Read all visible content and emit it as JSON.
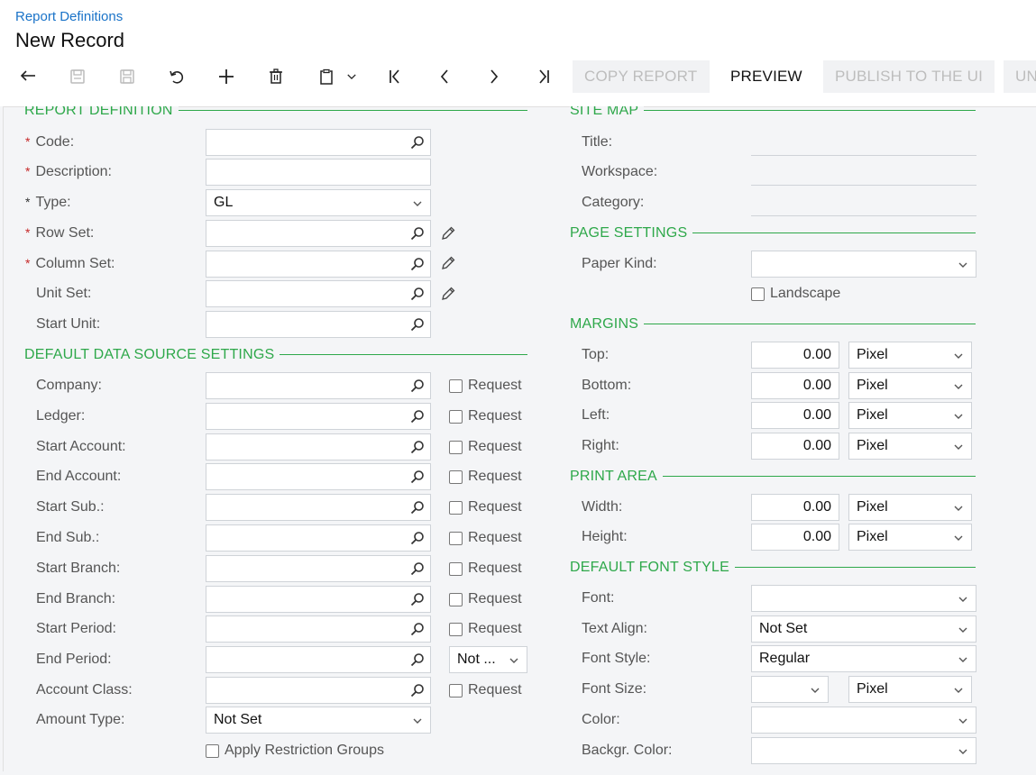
{
  "header": {
    "breadcrumb": "Report Definitions",
    "title": "New Record"
  },
  "toolbar": {
    "icons": [
      "undo-back-icon",
      "save-close-icon",
      "save-icon",
      "revert-icon",
      "add-icon",
      "delete-icon",
      "clipboard-icon",
      "first-record-icon",
      "previous-record-icon",
      "next-record-icon",
      "last-record-icon"
    ],
    "copy_report": "COPY REPORT",
    "preview": "PREVIEW",
    "publish": "PUBLISH TO THE UI",
    "unpublish": "UN"
  },
  "report_definition": {
    "title": "REPORT DEFINITION",
    "code_label": "Code:",
    "description_label": "Description:",
    "type_label": "Type:",
    "type_value": "GL",
    "row_set_label": "Row Set:",
    "column_set_label": "Column Set:",
    "unit_set_label": "Unit Set:",
    "start_unit_label": "Start Unit:"
  },
  "data_source": {
    "title": "DEFAULT DATA SOURCE SETTINGS",
    "request_label": "Request",
    "end_period_option": "Not ...",
    "rows": [
      {
        "label": "Company:"
      },
      {
        "label": "Ledger:"
      },
      {
        "label": "Start Account:"
      },
      {
        "label": "End Account:"
      },
      {
        "label": "Start Sub.:"
      },
      {
        "label": "End Sub.:"
      },
      {
        "label": "Start Branch:"
      },
      {
        "label": "End Branch:"
      },
      {
        "label": "Start Period:"
      },
      {
        "label": "End Period:"
      },
      {
        "label": "Account Class:"
      }
    ],
    "amount_type_label": "Amount Type:",
    "amount_type_value": "Not Set",
    "apply_restriction": "Apply Restriction Groups"
  },
  "site_map": {
    "title": "SITE MAP",
    "title_label": "Title:",
    "workspace_label": "Workspace:",
    "category_label": "Category:"
  },
  "page_settings": {
    "title": "PAGE SETTINGS",
    "paper_kind_label": "Paper Kind:",
    "landscape_label": "Landscape"
  },
  "margins": {
    "title": "MARGINS",
    "unit": "Pixel",
    "rows": [
      {
        "label": "Top:",
        "value": "0.00"
      },
      {
        "label": "Bottom:",
        "value": "0.00"
      },
      {
        "label": "Left:",
        "value": "0.00"
      },
      {
        "label": "Right:",
        "value": "0.00"
      }
    ]
  },
  "print_area": {
    "title": "PRINT AREA",
    "unit": "Pixel",
    "width_label": "Width:",
    "width_value": "0.00",
    "height_label": "Height:",
    "height_value": "0.00"
  },
  "font_style": {
    "title": "DEFAULT FONT STYLE",
    "font_label": "Font:",
    "text_align_label": "Text Align:",
    "text_align_value": "Not Set",
    "font_style_label": "Font Style:",
    "font_style_value": "Regular",
    "font_size_label": "Font Size:",
    "font_size_unit": "Pixel",
    "color_label": "Color:",
    "backgr_color_label": "Backgr. Color:"
  },
  "colors": {
    "accent_green": "#2ea84a",
    "link_blue": "#1a73c8",
    "required_red": "#c62828"
  }
}
